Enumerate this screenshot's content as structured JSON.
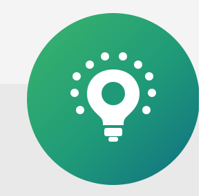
{
  "icon": {
    "name": "lightbulb-check-icon",
    "badge_gradient": [
      "#3bb56c",
      "#1f9a78",
      "#0f6f83"
    ],
    "glyph_color": "#ffffff"
  },
  "background": {
    "top_color": "#f4f4f4",
    "bottom_color": "#e9e9e9"
  }
}
